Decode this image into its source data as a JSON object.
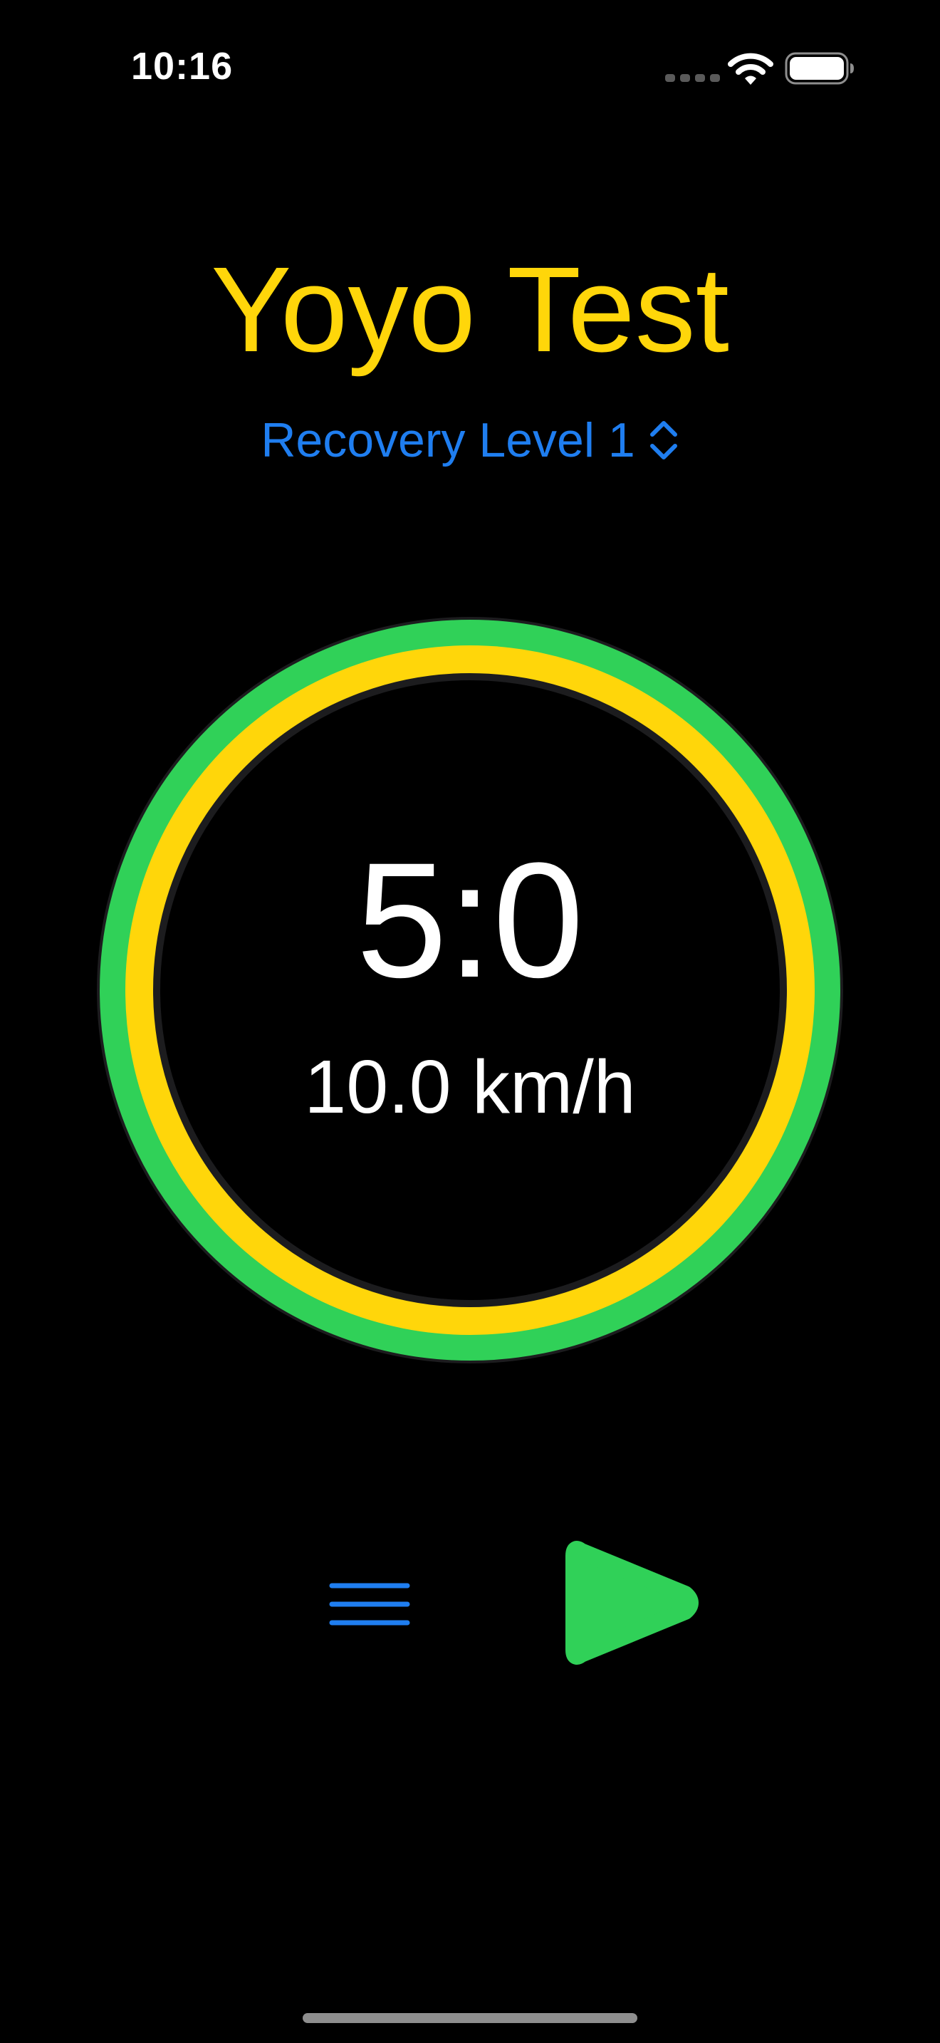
{
  "status_bar": {
    "time": "10:16",
    "wifi_icon": "wifi-icon",
    "battery_icon": "battery-icon",
    "signal_icon": "cellular-dots-icon"
  },
  "header": {
    "title": "Yoyo Test",
    "title_color": "#ffd60a"
  },
  "level_picker": {
    "selected": "Recovery Level 1",
    "icon": "chevron-up-down-icon",
    "color": "#1f7ef0"
  },
  "timer": {
    "value": "5:0",
    "speed": "10.0 km/h",
    "outer_ring_color": "#30d158",
    "inner_ring_color": "#ffd60a"
  },
  "controls": {
    "menu_icon": "hamburger-menu-icon",
    "play_icon": "play-icon",
    "menu_color": "#1f7ef0",
    "play_color": "#30d158"
  }
}
